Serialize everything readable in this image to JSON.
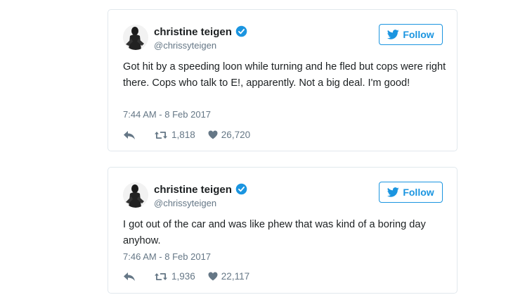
{
  "colors": {
    "accent": "#1b95e0",
    "border": "#e1e8ed",
    "secondary_text": "#657786",
    "primary_text": "#1c2022"
  },
  "tweets": [
    {
      "name": "christine teigen",
      "handle": "@chrissyteigen",
      "follow_label": "Follow",
      "text": "Got hit by a speeding loon while turning and he fled but cops were right there. Cops who talk to E!, apparently. Not a big deal. I'm good!",
      "timestamp": "7:44 AM - 8 Feb 2017",
      "retweets": "1,818",
      "likes": "26,720"
    },
    {
      "name": "christine teigen",
      "handle": "@chrissyteigen",
      "follow_label": "Follow",
      "text": "I got out of the car and was like phew that was kind of a boring day anyhow.",
      "timestamp": "7:46 AM - 8 Feb 2017",
      "retweets": "1,936",
      "likes": "22,117"
    }
  ],
  "icons": {
    "verified": "verified-badge-icon",
    "bird": "twitter-bird-icon",
    "reply": "reply-icon",
    "retweet": "retweet-icon",
    "like": "heart-icon"
  }
}
